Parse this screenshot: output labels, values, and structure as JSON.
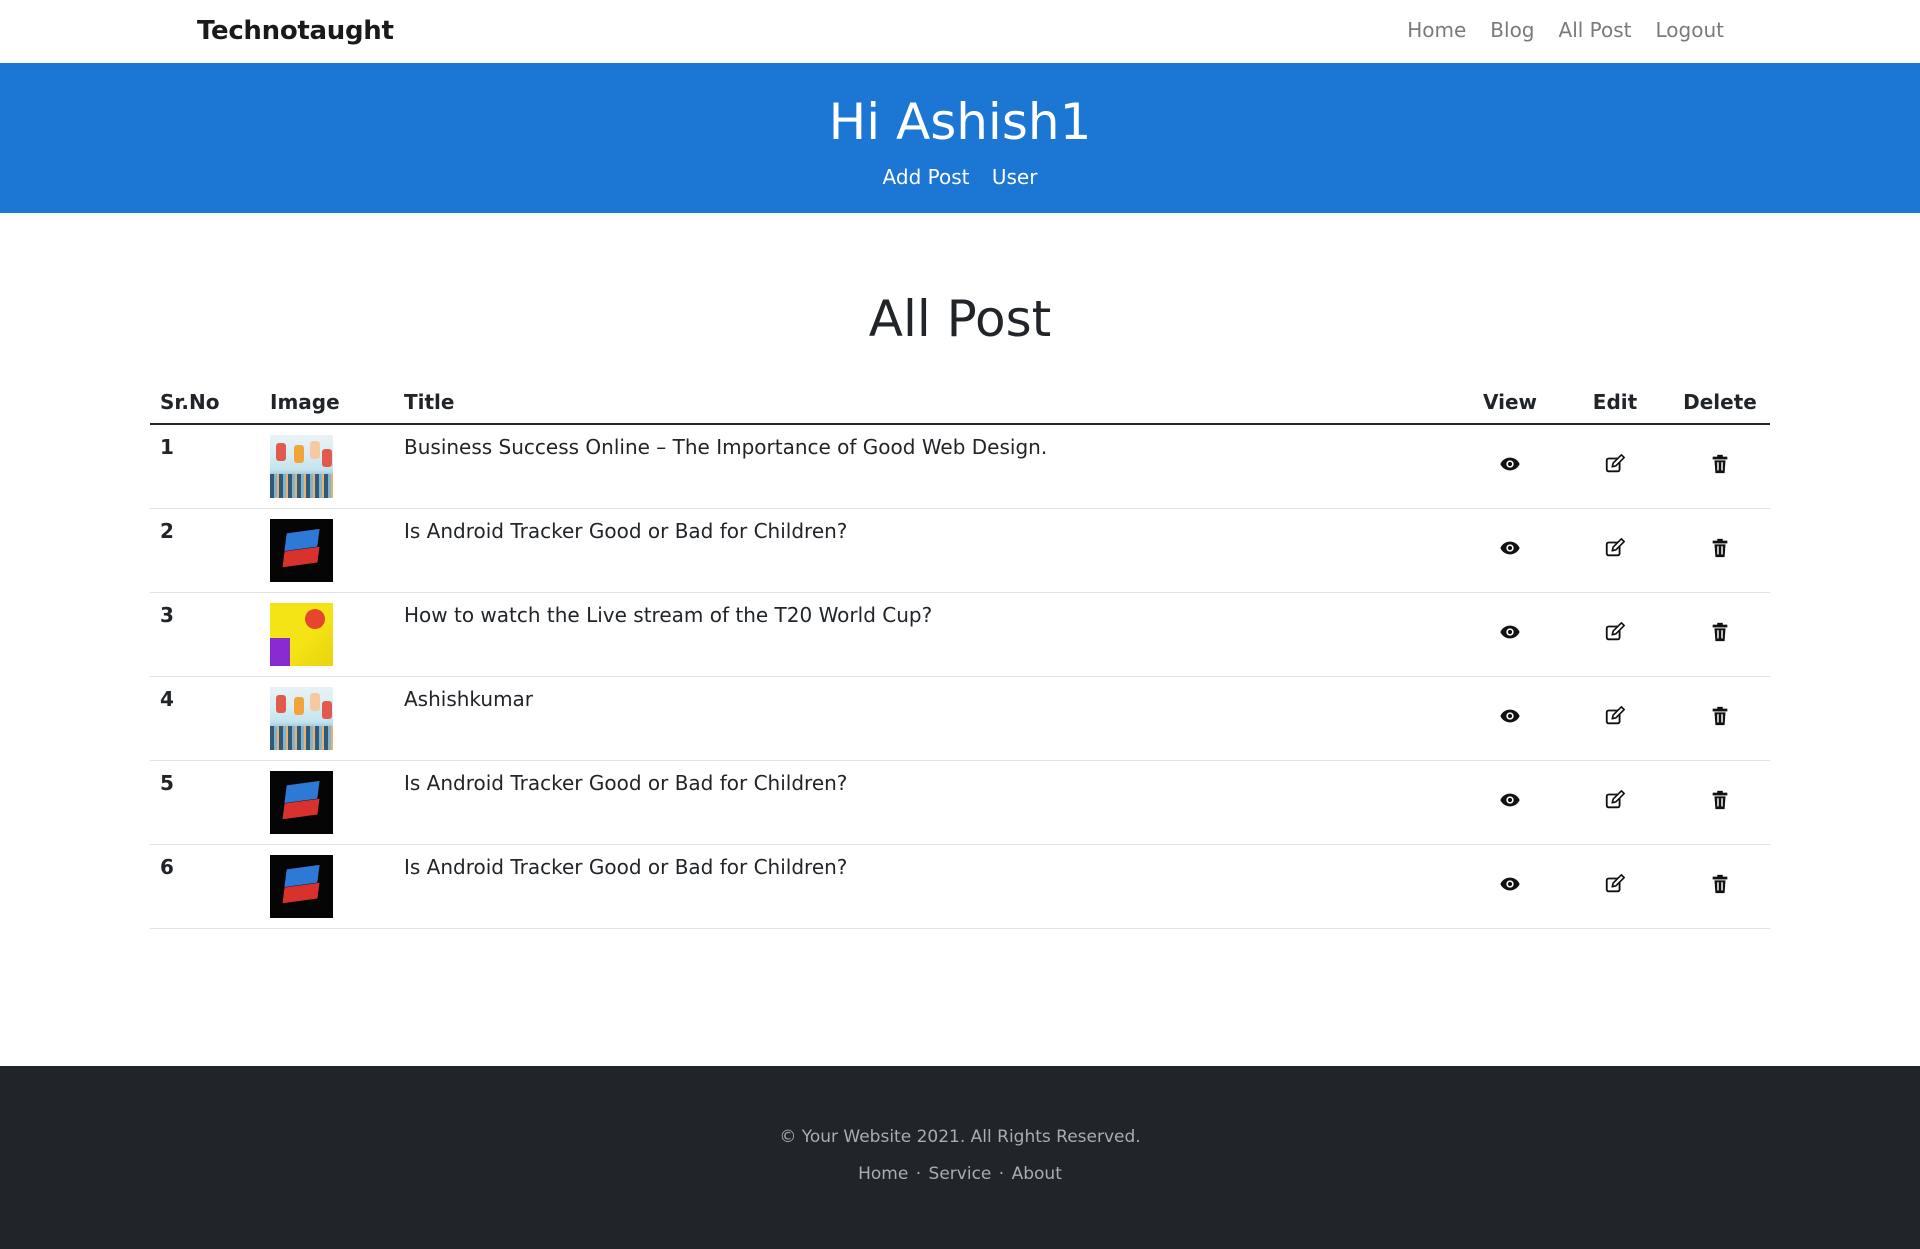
{
  "navbar": {
    "brand": "Technotaught",
    "links": [
      "Home",
      "Blog",
      "All Post",
      "Logout"
    ]
  },
  "hero": {
    "title": "Hi Ashish1",
    "links": [
      "Add Post",
      "User"
    ]
  },
  "main": {
    "title": "All Post",
    "columns": [
      "Sr.No",
      "Image",
      "Title",
      "View",
      "Edit",
      "Delete"
    ],
    "rows": [
      {
        "no": "1",
        "image": "crowd-thumbnail",
        "title": "Business Success Online – The Importance of Good Web Design."
      },
      {
        "no": "2",
        "image": "dark-thumbnail",
        "title": "Is Android Tracker Good or Bad for Children?"
      },
      {
        "no": "3",
        "image": "yellow-thumbnail",
        "title": "How to watch the Live stream of the T20 World Cup?"
      },
      {
        "no": "4",
        "image": "crowd-thumbnail",
        "title": "Ashishkumar"
      },
      {
        "no": "5",
        "image": "dark-thumbnail",
        "title": "Is Android Tracker Good or Bad for Children?"
      },
      {
        "no": "6",
        "image": "dark-thumbnail",
        "title": "Is Android Tracker Good or Bad for Children?"
      }
    ],
    "icons": {
      "view": "eye-icon",
      "edit": "edit-icon",
      "delete": "trash-icon"
    }
  },
  "footer": {
    "copyright": "© Your Website 2021. All Rights Reserved.",
    "links": [
      "Home",
      "Service",
      "About"
    ],
    "separator": "·"
  },
  "colors": {
    "hero_bg": "#1b76d4",
    "footer_bg": "#212529",
    "nav_link": "#7a7a7a"
  }
}
